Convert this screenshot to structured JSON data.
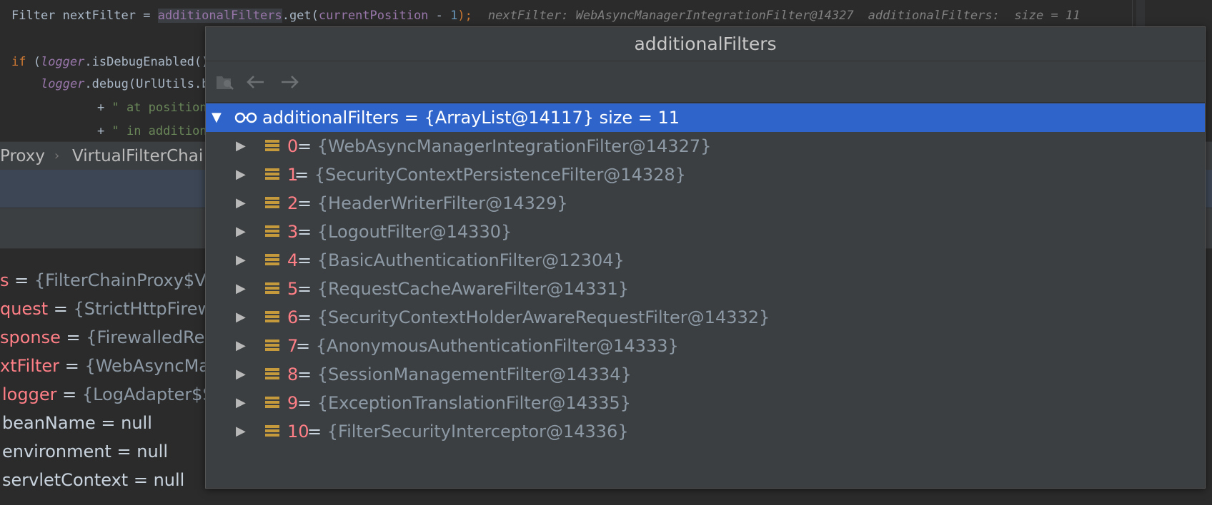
{
  "editor": {
    "line1": {
      "prefix": "Filter nextFilter = ",
      "field": "additionalFilters",
      "call": ".get(",
      "arg": "currentPosition",
      "minus": " - ",
      "num": "1",
      "close": ");",
      "hint1": "nextFilter: WebAsyncManagerIntegrationFilter@14327",
      "hint2": "additionalFilters:  size = 11"
    },
    "line2": {
      "kw": "if",
      "open": " (",
      "field": "logger",
      "rest": ".isDebugEnabled()"
    },
    "line3": {
      "field": "logger",
      "rest": ".debug(UrlUtils.b"
    },
    "line4": {
      "plus": "+ ",
      "str": "\" at position"
    },
    "line5": {
      "plus": "+ ",
      "str": "\" in addition"
    }
  },
  "breadcrumb": {
    "items": [
      "Proxy",
      "VirtualFilterChai"
    ],
    "separator": "›"
  },
  "variables": [
    {
      "name": "s",
      "eq": " = ",
      "value": "{FilterChainProxy$V",
      "style": "red"
    },
    {
      "name": "quest",
      "eq": " = ",
      "value": "{StrictHttpFirew",
      "style": "red"
    },
    {
      "name": "sponse",
      "eq": " = ",
      "value": "{FirewalledRes",
      "style": "red"
    },
    {
      "name": "xtFilter",
      "eq": " = ",
      "value": "{WebAsyncMa",
      "style": "red"
    },
    {
      "name": "logger",
      "eq": " = ",
      "value": "{LogAdapter$S",
      "style": "red"
    },
    {
      "name": "beanName",
      "eq": " = ",
      "value": "null",
      "style": "plain"
    },
    {
      "name": "environment",
      "eq": " = ",
      "value": "null",
      "style": "plain"
    },
    {
      "name": "servletContext",
      "eq": " = ",
      "value": "null",
      "style": "plain"
    }
  ],
  "popup": {
    "title": "additionalFilters",
    "toolbar": {
      "group_icon": "folder-group-icon",
      "back_icon": "back-arrow-icon",
      "forward_icon": "forward-arrow-icon"
    },
    "root": {
      "label": "additionalFilters = {ArrayList@14117}  size = 11",
      "expanded": true
    },
    "items": [
      {
        "index": "0",
        "eq": " = ",
        "value": "{WebAsyncManagerIntegrationFilter@14327}"
      },
      {
        "index": "1",
        "eq": " = ",
        "value": "{SecurityContextPersistenceFilter@14328}"
      },
      {
        "index": "2",
        "eq": " = ",
        "value": "{HeaderWriterFilter@14329}"
      },
      {
        "index": "3",
        "eq": " = ",
        "value": "{LogoutFilter@14330}"
      },
      {
        "index": "4",
        "eq": " = ",
        "value": "{BasicAuthenticationFilter@12304}"
      },
      {
        "index": "5",
        "eq": " = ",
        "value": "{RequestCacheAwareFilter@14331}"
      },
      {
        "index": "6",
        "eq": " = ",
        "value": "{SecurityContextHolderAwareRequestFilter@14332}"
      },
      {
        "index": "7",
        "eq": " = ",
        "value": "{AnonymousAuthenticationFilter@14333}"
      },
      {
        "index": "8",
        "eq": " = ",
        "value": "{SessionManagementFilter@14334}"
      },
      {
        "index": "9",
        "eq": " = ",
        "value": "{ExceptionTranslationFilter@14335}"
      },
      {
        "index": "10",
        "eq": " = ",
        "value": "{FilterSecurityInterceptor@14336}"
      }
    ]
  },
  "colors": {
    "selection": "#2f65ca",
    "index_red": "#ff7f87",
    "list_icon": "#c49a3c"
  }
}
